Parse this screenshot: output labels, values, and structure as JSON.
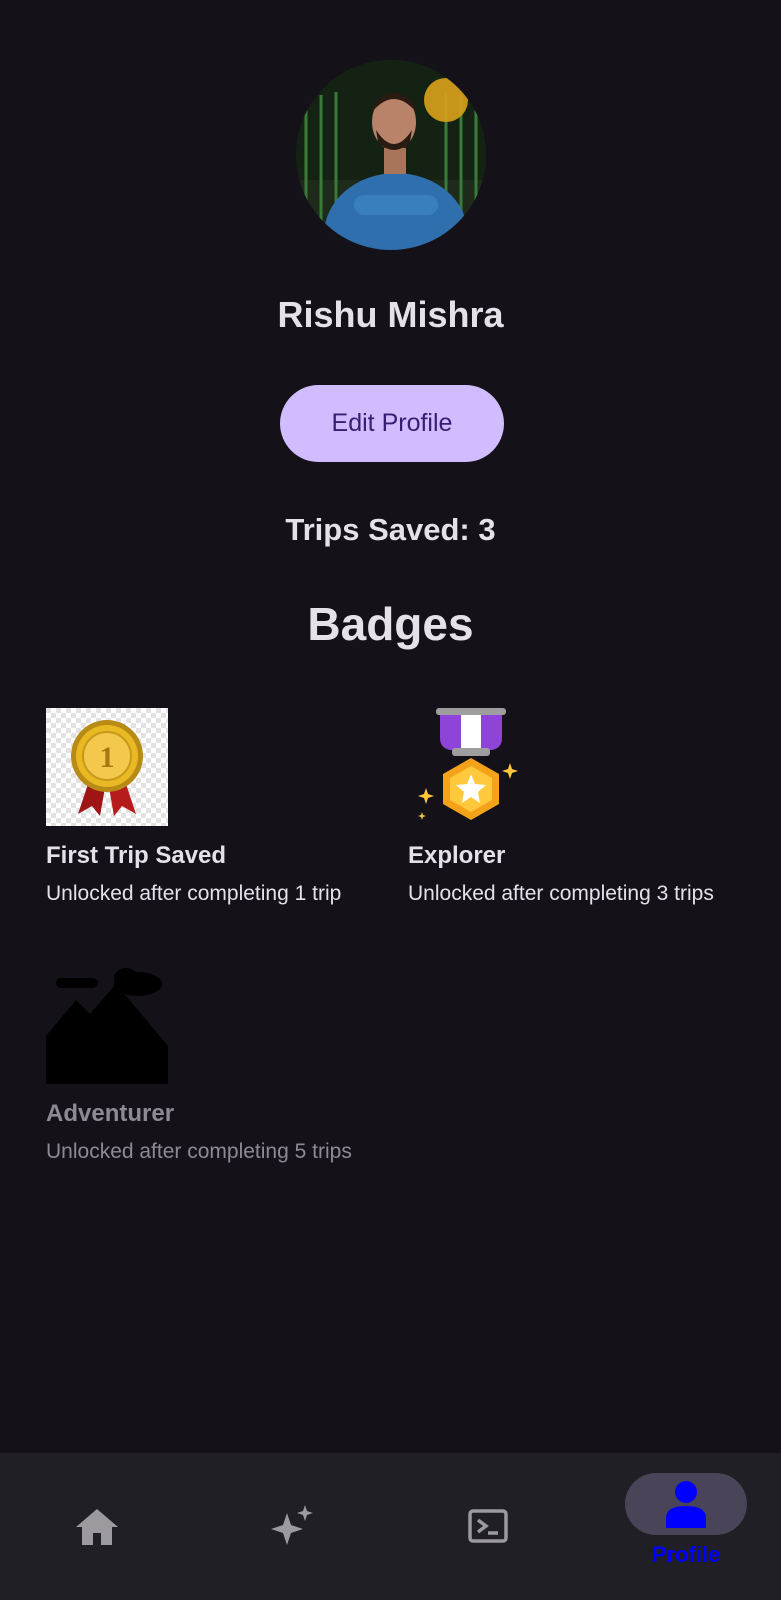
{
  "profile": {
    "name": "Rishu Mishra",
    "edit_label": "Edit Profile",
    "trips_saved": "Trips Saved: 3"
  },
  "badges": {
    "title": "Badges",
    "items": [
      {
        "title": "First Trip Saved",
        "desc": "Unlocked after completing 1 trip",
        "icon": "gold-medal-icon",
        "unlocked": true
      },
      {
        "title": "Explorer",
        "desc": "Unlocked after completing 3 trips",
        "icon": "explorer-medal-icon",
        "unlocked": true
      },
      {
        "title": "Adventurer",
        "desc": "Unlocked after completing 5 trips",
        "icon": "mountain-icon",
        "unlocked": false
      }
    ]
  },
  "nav": {
    "items": [
      {
        "icon": "home-icon"
      },
      {
        "icon": "sparkle-icon"
      },
      {
        "icon": "terminal-icon"
      },
      {
        "icon": "person-icon",
        "label": "Profile",
        "active": true
      }
    ],
    "active_color": "#0000ff"
  },
  "colors": {
    "background": "#141218",
    "button": "#d0bcff",
    "button_text": "#381e72",
    "navbar": "#211f26"
  }
}
